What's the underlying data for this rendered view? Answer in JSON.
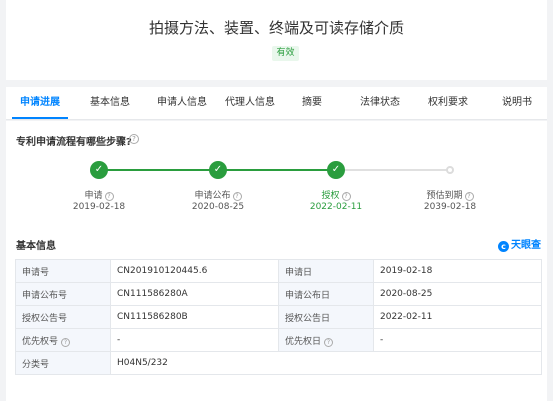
{
  "header": {
    "title": "拍摄方法、装置、终端及可读存储介质",
    "status_badge": "有效"
  },
  "tabs": [
    {
      "label": "申请进展",
      "active": true
    },
    {
      "label": "基本信息"
    },
    {
      "label": "申请人信息"
    },
    {
      "label": "代理人信息"
    },
    {
      "label": "摘要"
    },
    {
      "label": "法律状态"
    },
    {
      "label": "权利要求"
    },
    {
      "label": "说明书"
    }
  ],
  "timeline": {
    "question": "专利申请流程有哪些步骤?",
    "steps": [
      {
        "label": "申请",
        "date": "2019-02-18",
        "status": "done"
      },
      {
        "label": "申请公布",
        "date": "2020-08-25",
        "status": "done"
      },
      {
        "label": "授权",
        "date": "2022-02-11",
        "status": "current"
      },
      {
        "label": "预估到期",
        "date": "2039-02-18",
        "status": "pending"
      }
    ]
  },
  "basic_info": {
    "title": "基本信息",
    "brand": "天眼查",
    "rows": [
      [
        {
          "key": "申请号",
          "value": "CN201910120445.6"
        },
        {
          "key": "申请日",
          "value": "2019-02-18"
        }
      ],
      [
        {
          "key": "申请公布号",
          "value": "CN111586280A"
        },
        {
          "key": "申请公布日",
          "value": "2020-08-25"
        }
      ],
      [
        {
          "key": "授权公告号",
          "value": "CN111586280B"
        },
        {
          "key": "授权公告日",
          "value": "2022-02-11"
        }
      ],
      [
        {
          "key": "优先权号",
          "value": "-"
        },
        {
          "key": "优先权日",
          "value": "-"
        }
      ],
      [
        {
          "key": "分类号",
          "value": "H04N5/232"
        }
      ]
    ]
  },
  "colors": {
    "accent": "#0084ff",
    "success": "#2a9d3e",
    "pending": "#dcdcdc",
    "key_cell_bg": "#f4f7fc"
  }
}
